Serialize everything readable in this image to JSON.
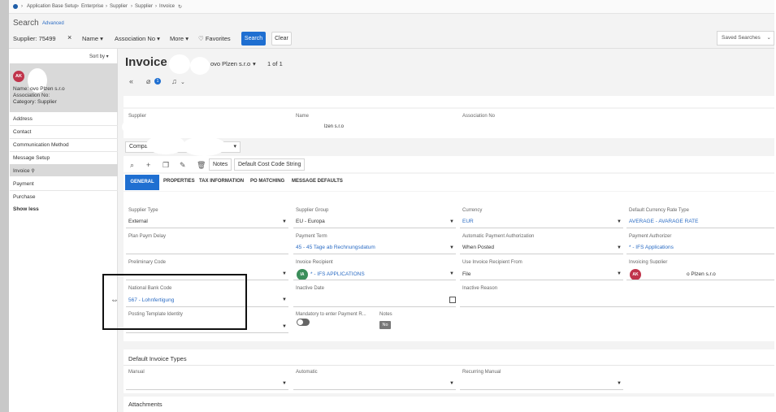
{
  "breadcrumb": [
    "Application Base Setup",
    "Enterprise",
    "Supplier",
    "Supplier",
    "Invoice"
  ],
  "search": {
    "title": "Search",
    "advanced": "Advanced"
  },
  "filters": {
    "supplier_chip": "Supplier: 75499",
    "name": "Name",
    "association": "Association No",
    "more": "More",
    "favorites": "Favorites",
    "search_btn": "Search",
    "clear_btn": "Clear",
    "saved_searches": "Saved Searches"
  },
  "sidebar": {
    "sort_by": "Sort by",
    "card": {
      "avatar": "AK",
      "name_line": "Name:        ovo Plzen s.r.o",
      "association_line": "Association No:",
      "category_line": "Category:   Supplier"
    },
    "items": [
      "Address",
      "Contact",
      "Communication Method",
      "Message Setup",
      "Invoice",
      "Payment",
      "Purchase",
      "Show less"
    ]
  },
  "header": {
    "title": "Invoice",
    "title_rest": "ovo Plzen s.r.o",
    "count": "1 of 1",
    "attach_count": "1"
  },
  "summary": {
    "supplier_label": "Supplier",
    "name_label": "Name",
    "name_value": "lzen s.r.o",
    "association_label": "Association No"
  },
  "company_select": "Compa",
  "toolbar": {
    "notes": "Notes",
    "default_cost": "Default Cost Code String"
  },
  "tabs": [
    "GENERAL",
    "PROPERTIES",
    "TAX INFORMATION",
    "PO MATCHING",
    "MESSAGE DEFAULTS"
  ],
  "form": {
    "supplier_type": {
      "label": "Supplier Type",
      "value": "External"
    },
    "supplier_group": {
      "label": "Supplier Group",
      "value": "EU - Europa"
    },
    "currency": {
      "label": "Currency",
      "value": "EUR"
    },
    "default_rate_type": {
      "label": "Default Currency Rate Type",
      "value": "AVERAGE - AVARAGE RATE"
    },
    "plan_paym_delay": {
      "label": "Plan Paym Delay"
    },
    "payment_term": {
      "label": "Payment Term",
      "value": "45 - 45 Tage ab Rechnungsdatum"
    },
    "auto_payment_auth": {
      "label": "Automatic Payment Authorization",
      "value": "When Posted"
    },
    "payment_authorizer": {
      "label": "Payment Authorizer",
      "value": "* - IFS Applications"
    },
    "preliminary_code": {
      "label": "Preliminary Code"
    },
    "invoice_recipient": {
      "label": "Invoice Recipient",
      "value": "* - IFS APPLICATIONS",
      "avatar": "IA"
    },
    "use_recipient_from": {
      "label": "Use Invoice Recipient From",
      "value": "File"
    },
    "invoicing_supplier": {
      "label": "Invoicing Supplier",
      "value": "o Plzen s.r.o",
      "avatar": "AK"
    },
    "national_bank_code": {
      "label": "National Bank Code",
      "value": "567 - Lohnfertigung"
    },
    "inactive_date": {
      "label": "Inactive Date"
    },
    "inactive_reason": {
      "label": "Inactive Reason"
    },
    "posting_template": {
      "label": "Posting Template Identity"
    },
    "mandatory_payment_ref": {
      "label": "Mandatory to enter Payment R..."
    },
    "notes": {
      "label": "Notes",
      "value": "No"
    }
  },
  "default_invoice_types": {
    "title": "Default Invoice Types",
    "manual": "Manual",
    "automatic": "Automatic",
    "recurring_manual": "Recurring Manual"
  },
  "attachments": "Attachments",
  "colors": {
    "accent": "#1f6fd1",
    "avatar": "#c0344b",
    "avatar_green": "#3b8e5a"
  }
}
